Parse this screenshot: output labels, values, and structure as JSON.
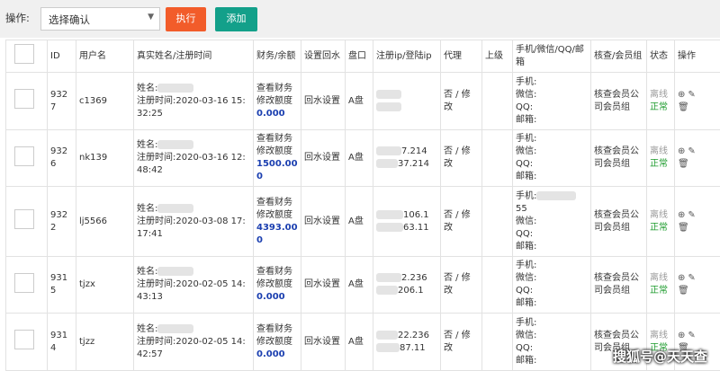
{
  "toolbar": {
    "label": "操作:",
    "select_value": "选择确认",
    "exec_label": "执行",
    "add_label": "添加"
  },
  "headers": [
    "ID",
    "用户名",
    "真实姓名/注册时间",
    "财务/余额",
    "设置回水",
    "盘口",
    "注册ip/登陆ip",
    "代理",
    "上级",
    "手机/微信/QQ/邮箱",
    "核查/会员组",
    "状态",
    "操作"
  ],
  "rows": [
    {
      "id": "9327",
      "username": "c1369",
      "name_label": "姓名:",
      "reg_time": "注册时间:2020-03-16 15:32:25",
      "finance_text": "查看财务修改额度",
      "balance": "0.000",
      "rebate": "回水设置",
      "market": "A盘",
      "ip1": "",
      "ip2": "",
      "agent": "否 / 修改",
      "phone": "手机:",
      "wechat": "微信:",
      "qq": "QQ:",
      "email": "邮箱:",
      "group": "核查会员公司会员组",
      "status1": "离线",
      "status2": "正常"
    },
    {
      "id": "9326",
      "username": "nk139",
      "name_label": "姓名:",
      "reg_time": "注册时间:2020-03-16 12:48:42",
      "finance_text": "查看财务修改额度",
      "balance": "1500.000",
      "rebate": "回水设置",
      "market": "A盘",
      "ip1": "7.214",
      "ip2": "37.214",
      "agent": "否 / 修改",
      "phone": "手机:",
      "wechat": "微信:",
      "qq": "QQ:",
      "email": "邮箱:",
      "group": "核查会员公司会员组",
      "status1": "离线",
      "status2": "正常"
    },
    {
      "id": "9322",
      "username": "lj5566",
      "name_label": "姓名:",
      "reg_time": "注册时间:2020-03-08 17:17:41",
      "finance_text": "查看财务修改额度",
      "balance": "4393.000",
      "rebate": "回水设置",
      "market": "A盘",
      "ip1": "106.1",
      "ip2": "63.11",
      "agent": "否 / 修改",
      "phone": "手机:",
      "phone_extra": "55",
      "wechat": "微信:",
      "qq": "QQ:",
      "email": "邮箱:",
      "group": "核查会员公司会员组",
      "status1": "离线",
      "status2": "正常"
    },
    {
      "id": "9315",
      "username": "tjzx",
      "name_label": "姓名:",
      "reg_time": "注册时间:2020-02-05 14:43:13",
      "finance_text": "查看财务修改额度",
      "balance": "0.000",
      "rebate": "回水设置",
      "market": "A盘",
      "ip1": "2.236",
      "ip2": "206.1",
      "agent": "否 / 修改",
      "phone": "手机:",
      "wechat": "微信:",
      "qq": "QQ:",
      "email": "邮箱:",
      "group": "核查会员公司会员组",
      "status1": "离线",
      "status2": "正常"
    },
    {
      "id": "9314",
      "username": "tjzz",
      "name_label": "姓名:",
      "reg_time": "注册时间:2020-02-05 14:42:57",
      "finance_text": "查看财务修改额度",
      "balance": "0.000",
      "rebate": "回水设置",
      "market": "A盘",
      "ip1": "22.236",
      "ip2": "87.11",
      "agent": "否 / 修改",
      "phone": "手机:",
      "wechat": "微信:",
      "qq": "QQ:",
      "email": "邮箱:",
      "group": "核查会员公司会员组",
      "status1": "离线",
      "status2": "正常"
    }
  ],
  "watermark": "搜狐号@天天查",
  "colors": {
    "exec": "#f25c2a",
    "add": "#13a08a",
    "money": "#1b3fb0",
    "normal": "#1a9a2a"
  }
}
